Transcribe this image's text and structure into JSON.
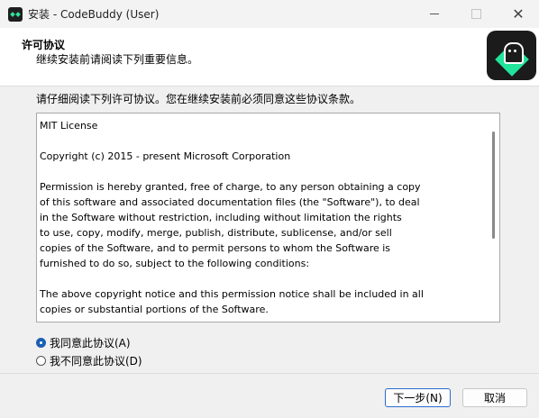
{
  "window": {
    "title": "安装 - CodeBuddy (User)"
  },
  "header": {
    "title": "许可协议",
    "subtitle": "继续安装前请阅读下列重要信息。"
  },
  "instruction": "请仔细阅读下列许可协议。您在继续安装前必须同意这些协议条款。",
  "license_lines": [
    "MIT License",
    "",
    "Copyright (c) 2015 - present Microsoft Corporation",
    "",
    "Permission is hereby granted, free of charge, to any person obtaining a copy",
    "of this software and associated documentation files (the \"Software\"), to deal",
    "in the Software without restriction, including without limitation the rights",
    "to use, copy, modify, merge, publish, distribute, sublicense, and/or sell",
    "copies of the Software, and to permit persons to whom the Software is",
    "furnished to do so, subject to the following conditions:",
    "",
    "The above copyright notice and this permission notice shall be included in all",
    "copies or substantial portions of the Software."
  ],
  "options": {
    "accept": "我同意此协议(A)",
    "decline": "我不同意此协议(D)",
    "selected": "accept"
  },
  "buttons": {
    "next": "下一步(N)",
    "cancel": "取消"
  },
  "icons": {
    "app": "codebuddy-app-icon",
    "logo": "codebuddy-logo",
    "minimize": "minimize-icon",
    "maximize": "maximize-icon",
    "close": "close-icon"
  },
  "colors": {
    "accent": "#1a5fb4",
    "brand_green": "#22e39b",
    "brand_dark": "#1b1b1b"
  }
}
